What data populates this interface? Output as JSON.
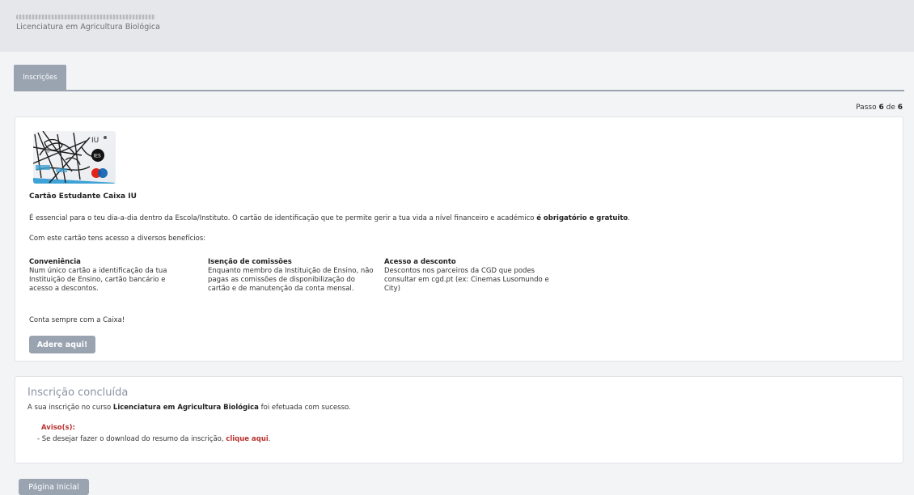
{
  "header": {
    "course": "Licenciatura em Agricultura Biológica"
  },
  "tabs": [
    {
      "label": "Inscrições"
    }
  ],
  "step": {
    "prefix": "Passo",
    "current": "6",
    "sep": "de",
    "total": "6"
  },
  "card": {
    "image_text": {
      "brand": "IU",
      "badge": "IES"
    },
    "title": "Cartão Estudante Caixa IU",
    "intro_pre": "É essencial para o teu dia-a-dia dentro da Escola/Instituto. O cartão de identificação que te permite gerir a tua vida a nível financeiro e académico ",
    "intro_bold": "é obrigatório e gratuito",
    "intro_post": ".",
    "benefits_intro": "Com este cartão tens acesso a diversos benefícios:",
    "benefits": [
      {
        "title": "Conveniência",
        "text": "Num único cartão a identificação da tua Instituição de Ensino, cartão bancário e acesso a descontos."
      },
      {
        "title": "Isenção de comissões",
        "text": "Enquanto membro da Instituição de Ensino, não pagas as comissões de disponibilização do cartão e de manutenção da conta mensal."
      },
      {
        "title": "Acesso a desconto",
        "text": "Descontos nos parceiros da CGD que podes consultar em cgd.pt (ex: Cinemas Lusomundo e City)"
      }
    ],
    "footer": "Conta sempre com a Caixa!",
    "button": "Adere aqui!"
  },
  "inscricao": {
    "title": "Inscrição concluída",
    "text_pre": "A sua inscrição no curso ",
    "course": "Licenciatura em Agricultura Biológica",
    "text_post": " foi efetuada com sucesso.",
    "aviso_title": "Aviso(s):",
    "aviso_pre": "- Se desejar fazer o download do resumo da inscrição, ",
    "aviso_link": "clique aqui",
    "aviso_post": "."
  },
  "home_button": "Página Inicial",
  "colors": {
    "accent": "#9aa4b1",
    "warning": "#b8322f",
    "title_muted": "#8a94a3"
  }
}
